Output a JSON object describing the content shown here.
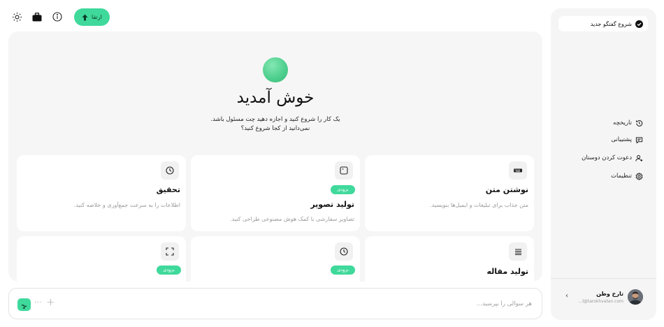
{
  "topbar": {
    "upgrade_label": "ارتقا",
    "icons": [
      "sun-icon",
      "briefcase-icon",
      "info-icon",
      "arrow-up-icon"
    ]
  },
  "main": {
    "title": "خوش آمدید",
    "subtitle_1": "یک کار را شروع کنید و اجازه دهید چت مسئول باشد.",
    "subtitle_2": "نمی‌دانید از کجا شروع کنید؟",
    "cards": [
      {
        "title": "نوشتن متن",
        "desc": "متن جذاب برای تبلیغات و ایمیل‌ها بنویسید.",
        "badge": "",
        "icon": "keyboard-icon"
      },
      {
        "title": "تولید تصویر",
        "desc": "تصاویر سفارشی با کمک هوش مصنوعی طراحی کنید.",
        "badge": "بزودی",
        "icon": "image-frame-icon"
      },
      {
        "title": "تحقیق",
        "desc": "اطلاعات را به سرعت جمع‌آوری و خلاصه کنید.",
        "badge": "",
        "icon": "clock-icon"
      },
      {
        "title": "تولید مقاله",
        "desc": "",
        "badge": "",
        "icon": "lines-icon"
      },
      {
        "title": "",
        "desc": "",
        "badge": "بزودی",
        "icon": "clock-icon"
      },
      {
        "title": "",
        "desc": "",
        "badge": "بزودی",
        "icon": "expand-icon"
      }
    ]
  },
  "chat": {
    "placeholder": "هر سوالی را بپرسید..."
  },
  "sidebar": {
    "new_chat_label": "شروع گفتگو جدید",
    "nav": [
      {
        "label": "تاریخچه",
        "icon": "history-icon"
      },
      {
        "label": "پشتیبانی",
        "icon": "support-chat-icon"
      },
      {
        "label": "دعوت کردن دوستان",
        "icon": "invite-friends-icon"
      },
      {
        "label": "تنظیمات",
        "icon": "gear-icon"
      }
    ],
    "user": {
      "name": "تارخ وطن",
      "email": "...l@tarokhvatan.com"
    }
  },
  "colors": {
    "accent": "#3fd99b",
    "panel_bg": "#f6f6f6",
    "sidebar_bg": "#f5f5f5"
  }
}
